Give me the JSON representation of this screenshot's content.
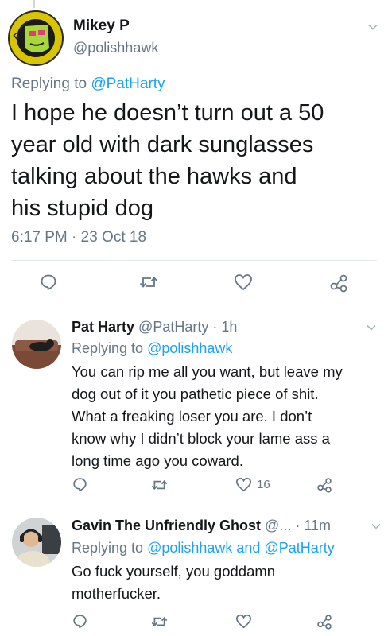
{
  "main_tweet": {
    "name": "Mikey P",
    "handle": "@polishhawk",
    "replying_label": "Replying to ",
    "replying_to": "@PatHarty",
    "text_lines": [
      "I hope he doesn’t turn out a 50",
      "year old with dark sunglasses",
      "talking about the hawks and",
      "his stupid dog"
    ],
    "timestamp": "6:17 PM · 23 Oct 18",
    "avatar_icon": "cartoon-avatar-icon"
  },
  "replies": [
    {
      "name": "Pat Harty",
      "handle": "@PatHarty",
      "time": "· 1h",
      "replying_label": "Replying to ",
      "replying_to": "@polishhawk",
      "text_lines": [
        "You can rip me all you want, but leave my",
        "dog out of it you pathetic piece of shit.",
        "What a freaking loser you are. I don’t",
        "know why I didn’t block your lame ass a",
        "long time ago you coward."
      ],
      "like_count": "16",
      "avatar_icon": "dog-on-couch-avatar-icon"
    },
    {
      "name": "Gavin The Unfriendly Ghost",
      "handle": "@...",
      "time": "· 11m",
      "replying_label": "Replying to ",
      "replying_to": "@polishhawk and @PatHarty",
      "text_lines": [
        "Go fuck yourself, you goddamn",
        "motherfucker."
      ],
      "avatar_icon": "man-with-headphones-avatar-icon"
    }
  ],
  "colors": {
    "link": "#1da1f2",
    "secondary_text": "#657786",
    "divider": "#e1e8ed",
    "icon": "#657786"
  }
}
